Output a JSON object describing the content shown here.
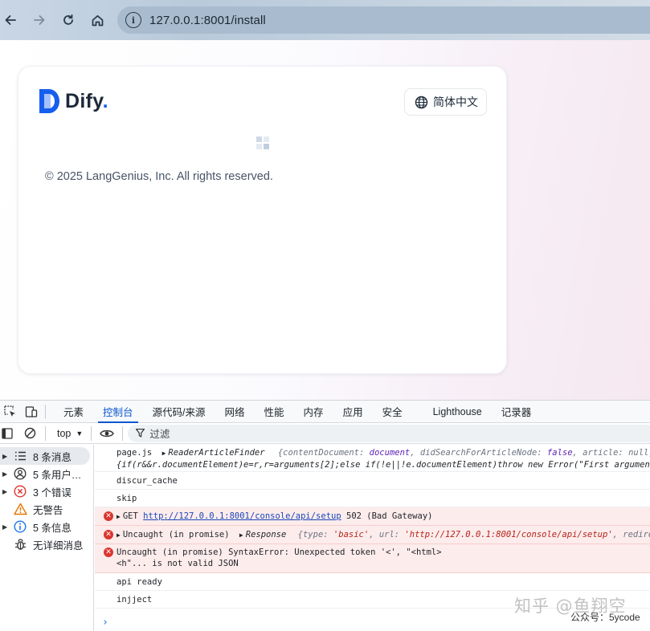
{
  "browser": {
    "url": "127.0.0.1:8001/install"
  },
  "page": {
    "logo_text": "Dify",
    "logo_dot": ".",
    "language_button": "简体中文",
    "copyright": "© 2025 LangGenius, Inc. All rights reserved.",
    "colors": {
      "brand": "#155eef",
      "logo_mark": "#155eef"
    }
  },
  "devtools": {
    "tabs": [
      {
        "label": "元素",
        "active": false
      },
      {
        "label": "控制台",
        "active": true
      },
      {
        "label": "源代码/来源",
        "active": false
      },
      {
        "label": "网络",
        "active": false
      },
      {
        "label": "性能",
        "active": false
      },
      {
        "label": "内存",
        "active": false
      },
      {
        "label": "应用",
        "active": false
      },
      {
        "label": "安全",
        "active": false
      },
      {
        "label": "Lighthouse",
        "active": false
      },
      {
        "label": "记录器",
        "active": false
      }
    ],
    "context": "top",
    "filter_placeholder": "过滤",
    "sidebar": [
      {
        "label": "8 条消息",
        "icon": "list-icon",
        "expandable": true,
        "selected": true
      },
      {
        "label": "5 条用户…",
        "icon": "user-icon",
        "expandable": true,
        "selected": false
      },
      {
        "label": "3 个错误",
        "icon": "error-icon",
        "expandable": true,
        "selected": false
      },
      {
        "label": "无警告",
        "icon": "warning-icon",
        "expandable": false,
        "selected": false
      },
      {
        "label": "5 条信息",
        "icon": "info-icon",
        "expandable": true,
        "selected": false
      },
      {
        "label": "无详细消息",
        "icon": "bug-icon",
        "expandable": false,
        "selected": false
      }
    ],
    "console": {
      "l1_a": "page.js",
      "l1_b": "ReaderArticleFinder",
      "l1_c": "{contentDocument: ",
      "l1_d": "document",
      "l1_e": ", didSearchForArticleNode: ",
      "l1_f": "false",
      "l1_g": ", article: null, didS",
      "l1_line2": "{if(r&&r.documentElement)e=r,r=arguments[2];else if(!e||!e.documentElement)throw new Error(\"First argument to R",
      "l2": "discur_cache",
      "l3": "skip",
      "l4_method": "GET",
      "l4_url": "http://127.0.0.1:8001/console/api/setup",
      "l4_status": "502 (Bad Gateway)",
      "l5_a": "Uncaught (in promise)",
      "l5_b": "Response",
      "l5_c": "{type: ",
      "l5_d": "'basic'",
      "l5_e": ", url: ",
      "l5_f": "'http://127.0.0.1:8001/console/api/setup'",
      "l5_g": ", redirected",
      "l6_line1": "Uncaught (in promise) SyntaxError: Unexpected token '<', \"<html>",
      "l6_line2": "<h\"... is not valid JSON",
      "l7": "api ready",
      "l8": "injject",
      "prompt": "›"
    }
  },
  "watermark": {
    "main": "知乎 @鱼翔空",
    "sub": "公众号：5ycode"
  }
}
